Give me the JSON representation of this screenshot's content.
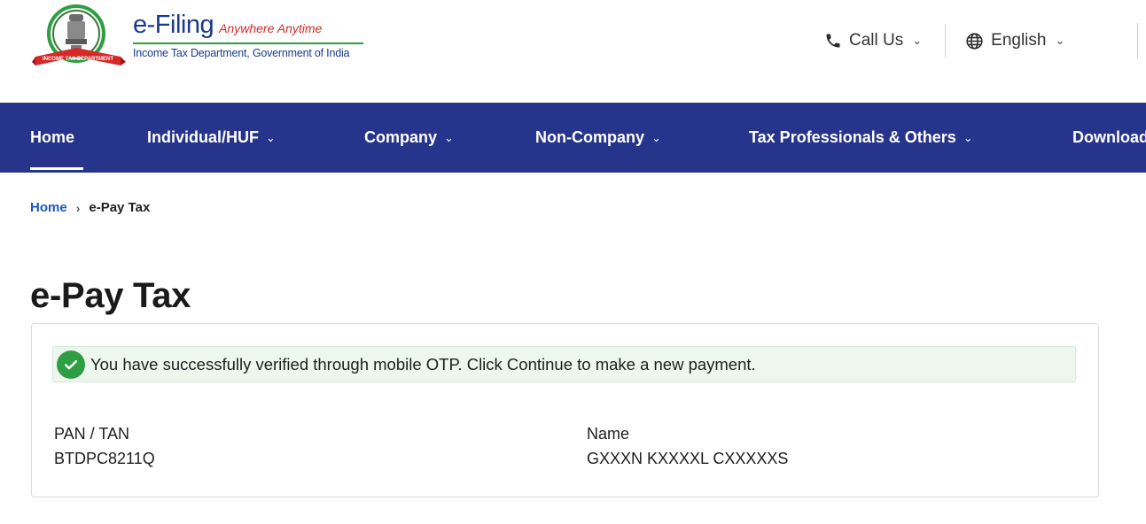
{
  "header": {
    "brand_title": "e-Filing",
    "brand_tagline": "Anywhere Anytime",
    "brand_subtitle": "Income Tax Department, Government of India",
    "emblem_ribbon_text": "INCOME TAX DEPARTMENT",
    "call_us_label": "Call Us",
    "language_label": "English"
  },
  "nav": {
    "items": [
      {
        "label": "Home",
        "active": true
      },
      {
        "label": "Individual/HUF"
      },
      {
        "label": "Company"
      },
      {
        "label": "Non-Company"
      },
      {
        "label": "Tax Professionals & Others"
      },
      {
        "label": "Downloads"
      }
    ]
  },
  "breadcrumb": {
    "home": "Home",
    "current": "e-Pay Tax"
  },
  "page": {
    "title": "e-Pay Tax"
  },
  "card": {
    "alert_text": "You have successfully verified through mobile OTP. Click Continue to make a new payment.",
    "pan_label": "PAN / TAN",
    "pan_value": "BTDPC8211Q",
    "name_label": "Name",
    "name_value": "GXXXN KXXXXL CXXXXXS"
  },
  "colors": {
    "nav_bg": "#27348b",
    "brand_blue": "#1b3a8c",
    "brand_red": "#d62828",
    "success_green": "#2e9e43",
    "link_blue": "#1f57c3"
  },
  "icons": {
    "call": "phone-icon",
    "language": "globe-icon",
    "dropdown": "chevron-down-icon",
    "success": "check-circle-icon"
  }
}
